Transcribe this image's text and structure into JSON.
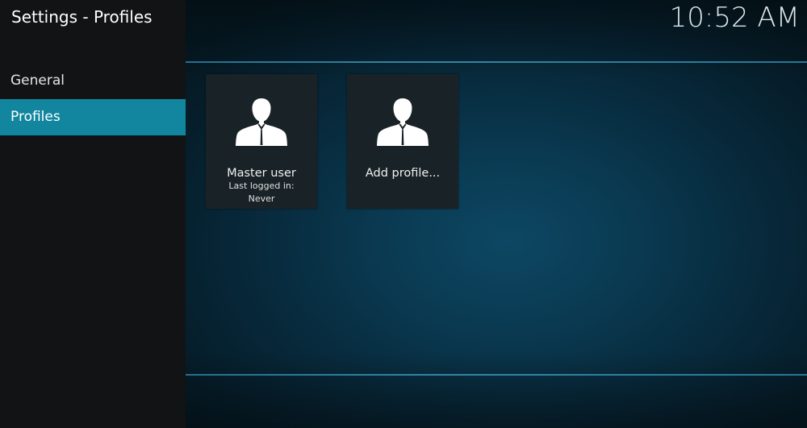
{
  "window": {
    "title": "Settings - Profiles",
    "clock": "10:52 AM"
  },
  "sidebar": {
    "items": [
      {
        "label": "General",
        "active": false
      },
      {
        "label": "Profiles",
        "active": true
      }
    ]
  },
  "profiles": [
    {
      "name": "Master user",
      "last_logged_label": "Last logged in:",
      "last_logged_value": "Never",
      "icon": "user-silhouette-icon"
    },
    {
      "name": "Add profile...",
      "icon": "user-silhouette-icon"
    }
  ],
  "colors": {
    "accent": "#12869f",
    "sidebar_bg": "#111315",
    "tile_bg": "#192226",
    "divider": "#3f95b6"
  }
}
